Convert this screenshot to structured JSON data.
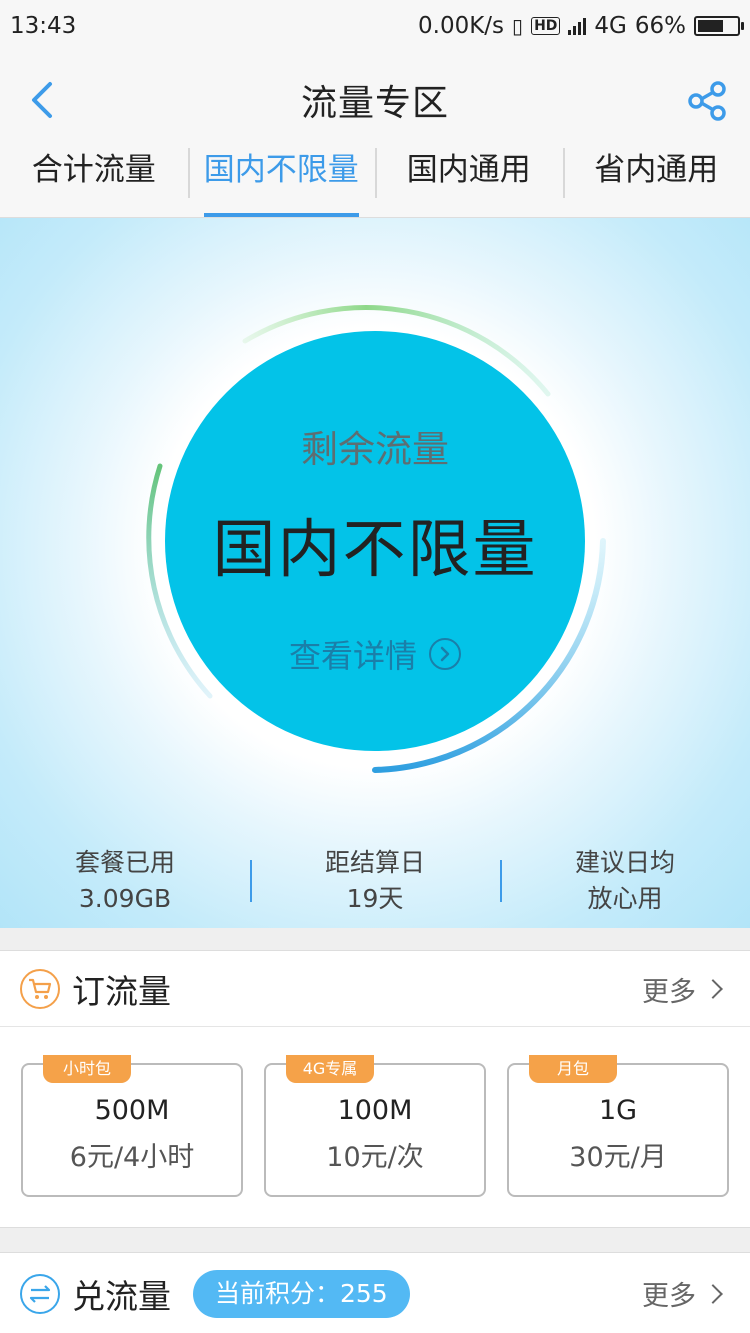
{
  "status_bar": {
    "time": "13:43",
    "net_speed": "0.00K/s",
    "hd": "HD",
    "network": "4G",
    "battery": "66%",
    "battery_level": 0.66
  },
  "header": {
    "title": "流量专区"
  },
  "tabs": [
    {
      "label": "合计流量",
      "active": false
    },
    {
      "label": "国内不限量",
      "active": true
    },
    {
      "label": "国内通用",
      "active": false
    },
    {
      "label": "省内通用",
      "active": false
    }
  ],
  "hero": {
    "label": "剩余流量",
    "value": "国内不限量",
    "details": "查看详情"
  },
  "stats": [
    {
      "key": "套餐已用",
      "value": "3.09GB"
    },
    {
      "key": "距结算日",
      "value": "19天"
    },
    {
      "key": "建议日均",
      "value": "放心用"
    }
  ],
  "order": {
    "title": "订流量",
    "more": "更多",
    "cards": [
      {
        "badge": "小时包",
        "size": "500M",
        "price": "6元/4小时"
      },
      {
        "badge": "4G专属",
        "size": "100M",
        "price": "10元/次"
      },
      {
        "badge": "月包",
        "size": "1G",
        "price": "30元/月"
      }
    ]
  },
  "exchange": {
    "title": "兑流量",
    "points": "当前积分：255",
    "more": "更多"
  },
  "colors": {
    "accent": "#3d9be9",
    "circle": "#03c3e8",
    "badge": "#f5a249"
  }
}
